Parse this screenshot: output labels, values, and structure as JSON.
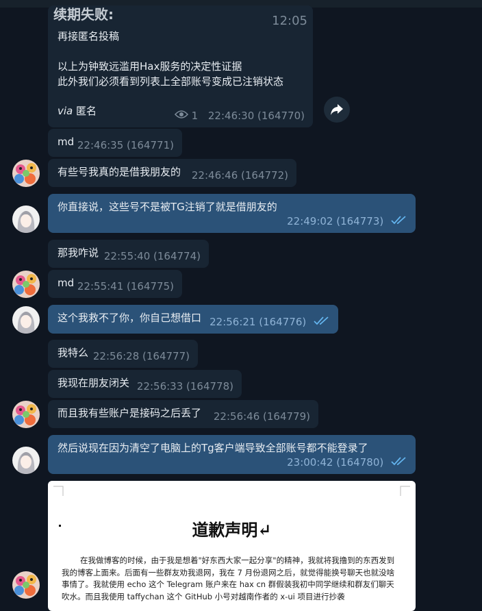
{
  "messages": {
    "m1": {
      "title": "续期失败:",
      "title_time": "12:05",
      "text": "再接匿名投稿\n\n以上为钟致远滥用Hax服务的决定性证据\n此外我们必须看到列表上全部账号变成已注销状态",
      "via_label": "via",
      "via_name": "匿名",
      "views": "1",
      "meta": "22:46:30 (164770)"
    },
    "m2": {
      "text": "md",
      "meta": "22:46:35 (164771)"
    },
    "m3": {
      "text": "有些号我真的是借我朋友的",
      "meta": "22:46:46 (164772)"
    },
    "m4": {
      "text": "你直接说，这些号不是被TG注销了就是借朋友的",
      "meta": "22:49:02 (164773)"
    },
    "m5": {
      "text": "那我咋说",
      "meta": "22:55:40 (164774)"
    },
    "m6": {
      "text": "md",
      "meta": "22:55:41 (164775)"
    },
    "m7": {
      "text": "这个我救不了你，你自己想借口",
      "meta": "22:56:21 (164776)"
    },
    "m8": {
      "text": "我特么",
      "meta": "22:56:28 (164777)"
    },
    "m9": {
      "text": "我现在朋友闭关",
      "meta": "22:56:33 (164778)"
    },
    "m10": {
      "text": "而且我有些账户是接码之后丢了",
      "meta": "22:56:46 (164779)"
    },
    "m11": {
      "text": "然后说现在因为清空了电脑上的Tg客户端导致全部账号都不能登录了",
      "meta": "23:00:42 (164780)"
    }
  },
  "document": {
    "title": "道歉声明↵",
    "body": "在我做博客的时候，由于我是想着\"好东西大家一起分享\"的精神，我就将我撸到的东西发到我的博客上面来。后面有一些群友劝我退网，我在 7 月份退网之后，就觉得能换号聊天也就没啥事情了。我就使用 echo 这个 Telegram 账户来在 hax cn 群假装我初中同学继续和群友们聊天吹水。而且我使用 taffychan 这个 GitHub 小号对越南作者的 x-ui 项目进行抄袭"
  },
  "colors": {
    "incoming": "#182533",
    "outgoing": "#2b5278",
    "background": "#0f1621",
    "check": "#64b5ef"
  },
  "icons": {
    "forward": "forward-arrow-icon",
    "views": "eye-icon",
    "read": "double-check-icon"
  }
}
